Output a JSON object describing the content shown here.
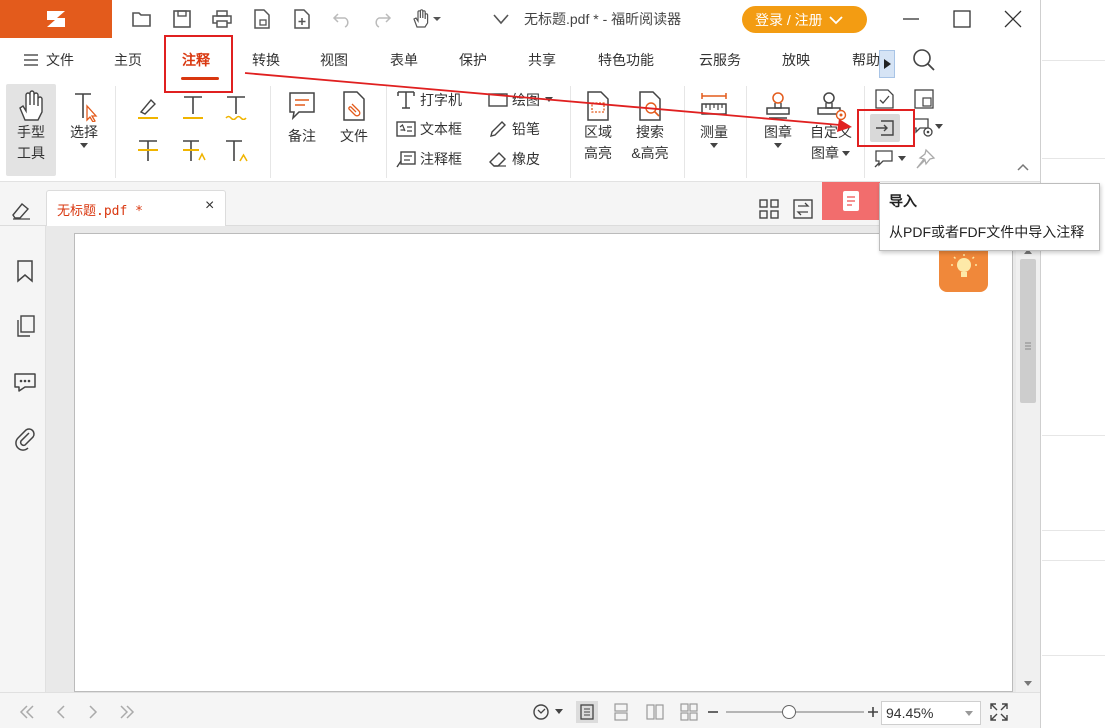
{
  "window": {
    "doc_title": "无标题.pdf * - 福昕阅读器",
    "login_label": "登录 / 注册"
  },
  "menu": {
    "file": "文件",
    "tabs": [
      "主页",
      "注释",
      "转换",
      "视图",
      "表单",
      "保护",
      "共享",
      "特色功能",
      "云服务",
      "放映",
      "帮助"
    ]
  },
  "ribbon": {
    "hand_tool": [
      "手型",
      "工具"
    ],
    "select": "选择",
    "note": "备注",
    "file_attach": "文件",
    "typewriter": "打字机",
    "textbox": "文本框",
    "callout": "注释框",
    "drawing": "绘图",
    "pencil": "铅笔",
    "eraser": "橡皮",
    "area_highlight": [
      "区域",
      "高亮"
    ],
    "search_highlight": [
      "搜索",
      "&高亮"
    ],
    "measure": "测量",
    "stamp": "图章",
    "custom_stamp": [
      "自定义",
      "图章"
    ]
  },
  "document_tab": {
    "label": "无标题.pdf *",
    "close": "×"
  },
  "tooltip": {
    "title": "导入",
    "description": "从PDF或者FDF文件中导入注释"
  },
  "status": {
    "zoom": "94.45%"
  },
  "colors": {
    "brand": "#e35b1c",
    "accent_red": "#d9370f",
    "login": "#f39c12",
    "annotation_red": "#e02020",
    "bulb": "#f0883a"
  }
}
